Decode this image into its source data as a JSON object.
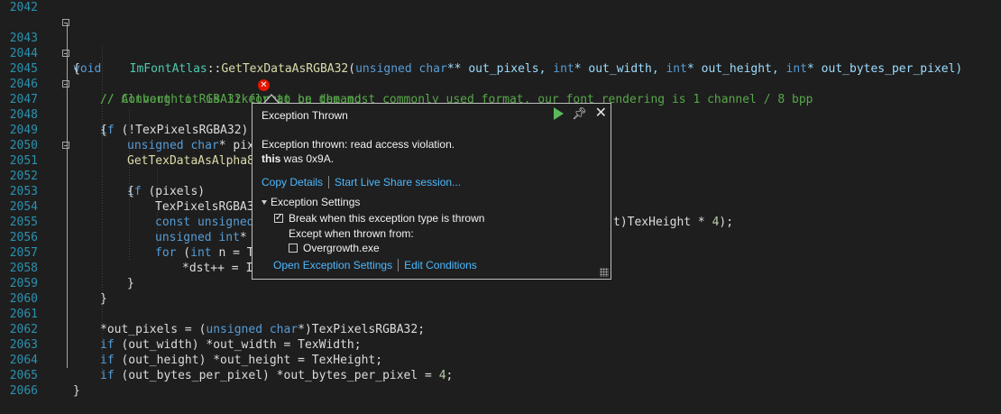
{
  "line_numbers": [
    "2042",
    "2043",
    "2044",
    "2045",
    "2046",
    "2047",
    "2048",
    "2049",
    "2050",
    "2051",
    "2052",
    "2053",
    "2054",
    "2055",
    "2056",
    "2057",
    "2058",
    "2059",
    "2060",
    "2061",
    "2062",
    "2063",
    "2064",
    "2065",
    "2066"
  ],
  "code": {
    "l2043": {
      "kw": "void",
      "cls": "ImFontAtlas",
      "sep": "::",
      "fn": "GetTexDataAsRGBA32",
      "open": "(",
      "t1": "unsigned char",
      "p1": "** out_pixels, ",
      "t2": "int",
      "p2": "* out_width, ",
      "t3": "int",
      "p3": "* out_height, ",
      "t4": "int",
      "p4": "* out_bytes_per_pixel)"
    },
    "l2044": "{",
    "l2045": "// Convert to RGBA32 format on demand",
    "l2046": "// Although it is likely to be the most commonly used format, our font rendering is 1 channel / 8 bpp",
    "l2047": {
      "kw": "if",
      "rest": " (!TexPixelsRGBA32)"
    },
    "l2048": "{",
    "l2049": {
      "kw": "unsigned char",
      "rest": "* pix"
    },
    "l2050": {
      "fn": "GetTexDataAsAlpha8"
    },
    "l2051": {
      "kw": "if",
      "rest": " (pixels)"
    },
    "l2052": "{",
    "l2053": {
      "a": "TexPixelsRGBA3",
      "b": "t)TexHeight * ",
      "n": "4",
      "c": ");"
    },
    "l2054": {
      "kw": "const unsigned"
    },
    "l2055": {
      "kw": "unsigned int",
      "rest": "*"
    },
    "l2056": {
      "kw": "for",
      "rest": " (",
      "kw2": "int",
      "rest2": " n = T"
    },
    "l2057": {
      "rest": "*dst++ = I"
    },
    "l2058": "}",
    "l2059": "}",
    "l2061": {
      "a": "*out_pixels = (",
      "kw": "unsigned char",
      "b": "*)TexPixelsRGBA32;"
    },
    "l2062": {
      "kw": "if",
      "a": " (out_width) *out_width = TexWidth;"
    },
    "l2063": {
      "kw": "if",
      "a": " (out_height) *out_height = TexHeight;"
    },
    "l2064": {
      "kw": "if",
      "a": " (out_bytes_per_pixel) *out_bytes_per_pixel = ",
      "n": "4",
      "b": ";"
    },
    "l2065": "}"
  },
  "error_glyph": "✕",
  "popup": {
    "title": "Exception Thrown",
    "message_line1": "Exception thrown: read access violation.",
    "message_bold": "this",
    "message_line2_rest": " was 0x9A.",
    "copy_details": "Copy Details",
    "live_share": "Start Live Share session...",
    "settings_header": "Exception Settings",
    "break_label": "Break when this exception type is thrown",
    "break_checked": true,
    "except_label": "Except when thrown from:",
    "module_label": "Overgrowth.exe",
    "module_checked": false,
    "open_settings": "Open Exception Settings",
    "edit_conditions": "Edit Conditions",
    "icons": {
      "continue": "play-icon",
      "pin": "pin-icon",
      "close": "close-icon"
    }
  },
  "colors": {
    "background": "#1e1e1e",
    "line_number": "#2b91af",
    "keyword": "#569cd6",
    "comment": "#57a64a",
    "function": "#dcdcaa",
    "link": "#4db8ff",
    "error": "#e51400"
  }
}
